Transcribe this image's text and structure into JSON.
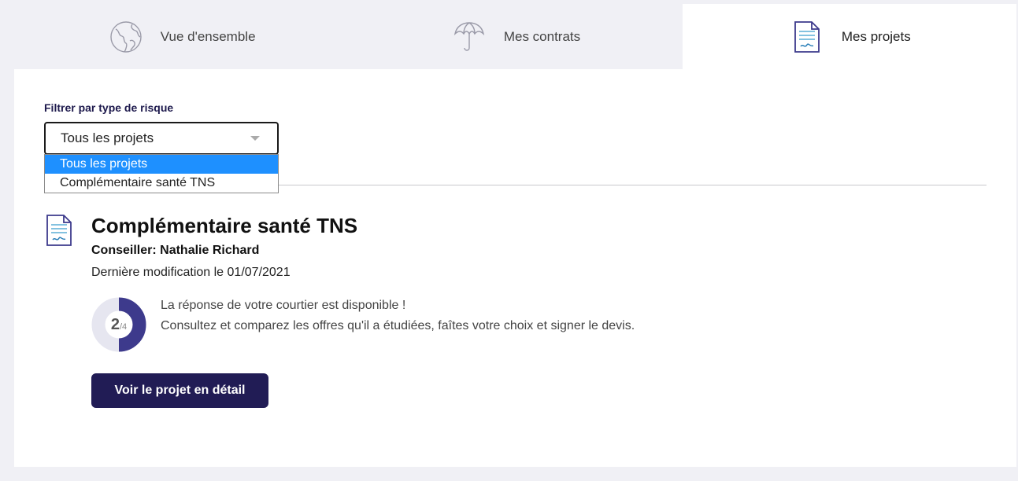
{
  "tabs": [
    {
      "label": "Vue d'ensemble",
      "icon": "globe-icon"
    },
    {
      "label": "Mes contrats",
      "icon": "umbrella-icon"
    },
    {
      "label": "Mes projets",
      "icon": "document-icon"
    }
  ],
  "filter": {
    "label": "Filtrer par type de risque",
    "selected": "Tous les projets",
    "options": [
      "Tous les projets",
      "Complémentaire santé TNS"
    ]
  },
  "project": {
    "title": "Complémentaire santé TNS",
    "advisor": "Conseiller: Nathalie Richard",
    "modified": "Dernière modification le 01/07/2021",
    "progress": {
      "current": "2",
      "total": "/4"
    },
    "message_line1": "La réponse de votre courtier est disponible !",
    "message_line2": "Consultez et comparez les offres qu'il a étudiées, faîtes votre choix et signer le devis.",
    "cta": "Voir le projet en détail"
  },
  "colors": {
    "accent": "#211c55",
    "progress_fill": "#3d3a8c",
    "progress_track": "#e6e6f0",
    "option_highlight": "#1e90ff"
  }
}
